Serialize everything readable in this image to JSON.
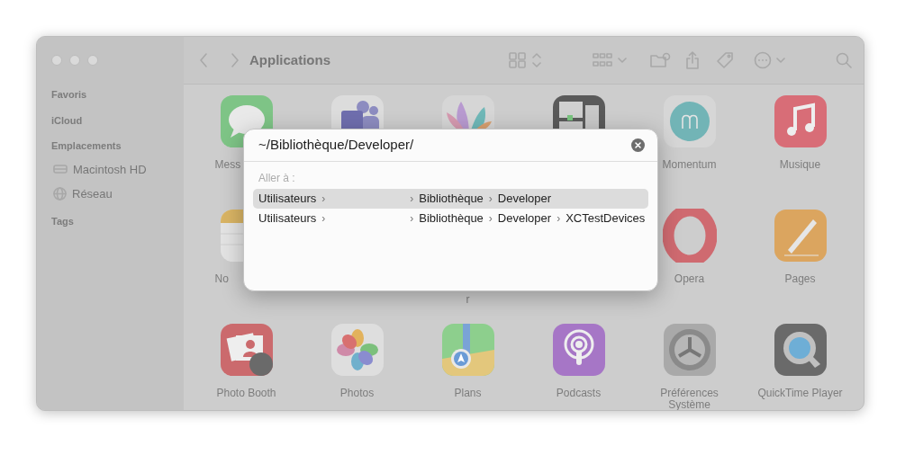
{
  "window": {
    "title": "Applications"
  },
  "sidebar": [
    {
      "heading": "Favoris"
    },
    {
      "heading": "iCloud"
    },
    {
      "heading": "Emplacements",
      "items": [
        {
          "label": "Macintosh HD",
          "kind": "disk"
        },
        {
          "label": "Réseau",
          "kind": "network"
        }
      ]
    },
    {
      "heading": "Tags"
    }
  ],
  "apps": [
    {
      "label": "Mess"
    },
    {
      "label": "Momentum"
    },
    {
      "label": "Musique"
    },
    {
      "label": "No"
    },
    {
      "label": "r"
    },
    {
      "label": "Opera"
    },
    {
      "label": "Pages"
    },
    {
      "label": "Photo Booth"
    },
    {
      "label": "Photos"
    },
    {
      "label": "Plans"
    },
    {
      "label": "Podcasts"
    },
    {
      "label": "Préférences Système"
    },
    {
      "label": "QuickTime Player"
    }
  ],
  "goto_dialog": {
    "path_field": {
      "value": "~/Bibliothèque/Developer/"
    },
    "heading": "Aller à :",
    "separator": "›",
    "results": [
      {
        "segments": [
          "Utilisateurs",
          "Bibliothèque",
          "Developer"
        ],
        "selected": true
      },
      {
        "segments": [
          "Utilisateurs",
          "Bibliothèque",
          "Developer",
          "XCTestDevices"
        ],
        "selected": false
      }
    ]
  }
}
